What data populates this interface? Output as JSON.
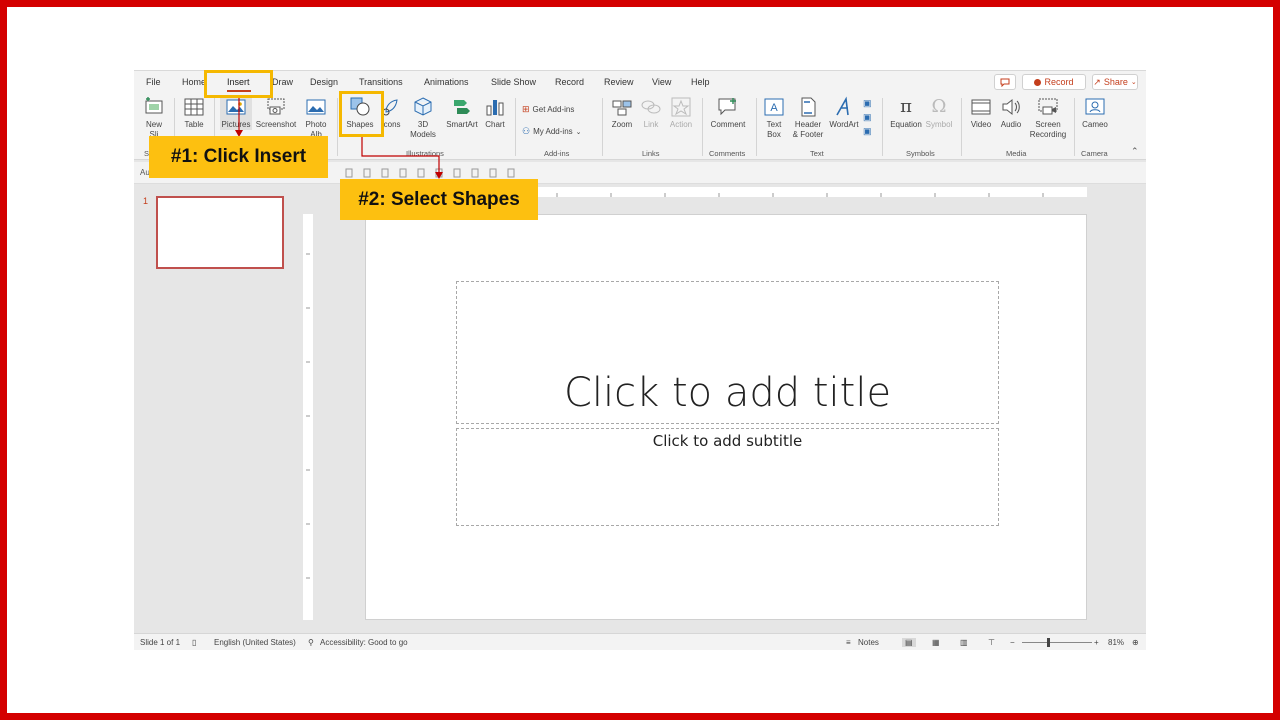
{
  "tabs": [
    "File",
    "Home",
    "Insert",
    "Draw",
    "Design",
    "Transitions",
    "Animations",
    "Slide Show",
    "Record",
    "Review",
    "View",
    "Help"
  ],
  "top_buttons": {
    "record": "Record",
    "share": "Share"
  },
  "ribbon": {
    "new_slide": [
      "New",
      "Sli"
    ],
    "table": "Table",
    "pictures": "Pictures",
    "screenshot": "Screenshot",
    "photo_album": [
      "Photo",
      "Alb"
    ],
    "shapes": "Shapes",
    "icons": "Icons",
    "models_3d": [
      "3D",
      "Models"
    ],
    "smartart": "SmartArt",
    "chart": "Chart",
    "get_addins": "Get Add-ins",
    "my_addins": "My Add-ins",
    "zoom": "Zoom",
    "link": "Link",
    "action": "Action",
    "comment": "Comment",
    "text_box": [
      "Text",
      "Box"
    ],
    "header_footer": [
      "Header",
      "& Footer"
    ],
    "wordart": "WordArt",
    "equation": "Equation",
    "symbol": "Symbol",
    "video": "Video",
    "audio": "Audio",
    "screen_recording": [
      "Screen",
      "Recording"
    ],
    "cameo": "Cameo"
  },
  "groups": {
    "slides": "Sl",
    "illustrations": "Illustrations",
    "addins": "Add-ins",
    "links": "Links",
    "comments": "Comments",
    "text": "Text",
    "symbols": "Symbols",
    "media": "Media",
    "camera": "Camera"
  },
  "format_bar": {
    "font_prefix": "Au"
  },
  "thumbnail": {
    "number": "1"
  },
  "slide": {
    "title_placeholder": "Click to add title",
    "subtitle_placeholder": "Click to add subtitle"
  },
  "status": {
    "slide_count": "Slide 1 of 1",
    "language": "English (United States)",
    "accessibility": "Accessibility: Good to go",
    "notes": "Notes",
    "zoom": "81%"
  },
  "callouts": {
    "step1": "#1: Click Insert",
    "step2": "#2: Select Shapes"
  },
  "colors": {
    "frame": "#d40000",
    "accent": "#c43e1c",
    "highlight": "#f5b800",
    "callout_bg": "#fdc010"
  }
}
